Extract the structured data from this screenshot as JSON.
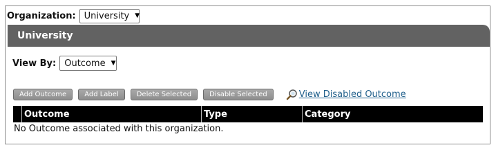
{
  "organization": {
    "label": "Organization:",
    "selected": "University"
  },
  "section": {
    "title": "University"
  },
  "view_by": {
    "label": "View By:",
    "selected": "Outcome"
  },
  "actions": {
    "add_outcome": "Add Outcome",
    "add_label": "Add Label",
    "delete_selected": "Delete Selected",
    "disable_selected": "Disable Selected",
    "view_disabled": "View Disabled Outcome",
    "view_disabled_icon": "magnifier-icon"
  },
  "table": {
    "columns": [
      "Outcome",
      "Type",
      "Category"
    ],
    "empty_message": "No Outcome associated with this organization."
  },
  "colors": {
    "section_bar": "#626262",
    "table_header": "#000000",
    "button": "#9a9a9a",
    "link": "#1f5f8b"
  }
}
